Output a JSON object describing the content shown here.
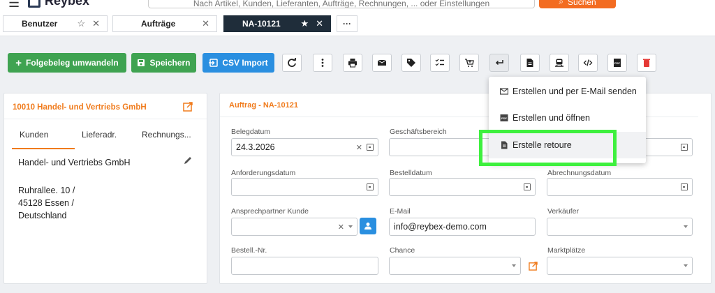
{
  "header": {
    "app_name": "Reybex",
    "search_placeholder": "Nach Artikel, Kunden, Lieferanten, Aufträge, Rechnungen, ... oder Einstellungen",
    "search_button": "Suchen"
  },
  "tabs": [
    {
      "label": "Benutzer",
      "star": "☆",
      "close": "✕"
    },
    {
      "label": "Aufträge",
      "close": "✕"
    },
    {
      "label": "NA-10121",
      "star": "★",
      "close": "✕"
    },
    {
      "label": "···"
    }
  ],
  "toolbar": {
    "convert_label": "Folgebeleg umwandeln",
    "save_label": "Speichern",
    "csv_label": "CSV Import",
    "icons": [
      "refresh-icon",
      "more-vert-icon",
      "print-icon",
      "mail-icon",
      "tag-icon",
      "checklist-icon",
      "cart-icon",
      "return-icon",
      "document-icon",
      "transport-icon",
      "code-icon",
      "pdf-icon",
      "delete-icon"
    ]
  },
  "left_card": {
    "title": "10010 Handel- und Vertriebs GmbH",
    "tabs": [
      "Kunden",
      "Lieferadr.",
      "Rechnungs..."
    ],
    "name": "Handel- und Vertriebs GmbH",
    "address_line1": "Ruhrallee. 10 /",
    "address_line2": "45128 Essen /",
    "address_line3": "Deutschland"
  },
  "main_card": {
    "title": "Auftrag - NA-10121",
    "fields": {
      "belegdatum_label": "Belegdatum",
      "belegdatum_value": "24.3.2026",
      "geschaeftsbereich_label": "Geschäftsbereich",
      "anforderungsdatum_label": "Anforderungsdatum",
      "bestelldatum_label": "Bestelldatum",
      "abrechnungsdatum_label": "Abrechnungsdatum",
      "ansprechpartner_label": "Ansprechpartner Kunde",
      "email_label": "E-Mail",
      "email_value": "info@reybex-demo.com",
      "verkaeufer_label": "Verkäufer",
      "bestellnr_label": "Bestell.-Nr.",
      "chance_label": "Chance",
      "marktplaetze_label": "Marktplätze"
    }
  },
  "dropdown": {
    "items": [
      {
        "label": "Erstellen und per E-Mail senden",
        "icon": "mail-icon"
      },
      {
        "label": "Erstellen und öffnen",
        "icon": "pdf-icon"
      },
      {
        "label": "Erstelle retoure",
        "icon": "document-icon"
      }
    ]
  },
  "colors": {
    "accent_orange": "#f07b1c",
    "green": "#3fa351",
    "blue": "#2a8fe0",
    "highlight": "#3ef03e",
    "dark_tab": "#1f2d3a"
  }
}
